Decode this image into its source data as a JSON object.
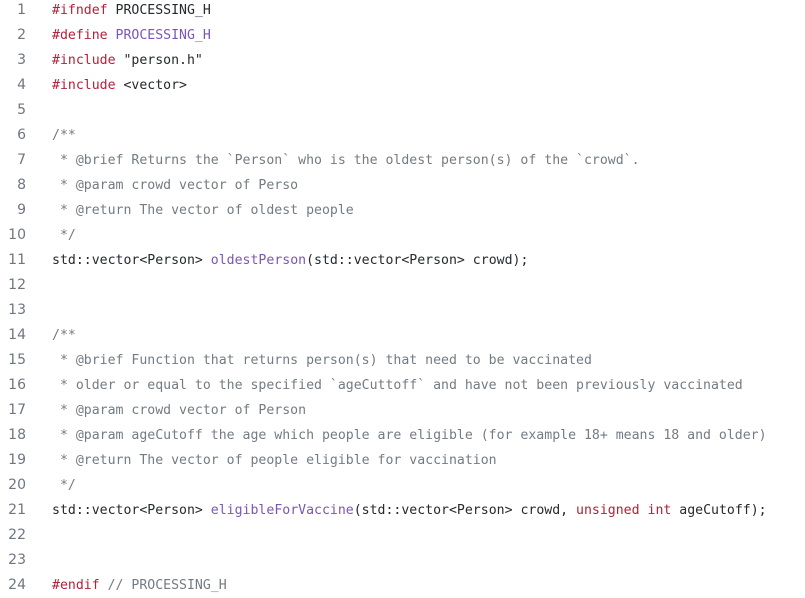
{
  "file": {
    "lines": [
      {
        "number": "1",
        "tokens": [
          {
            "t": "#ifndef",
            "k": "preproc"
          },
          {
            "t": " PROCESSING_H",
            "k": "plain"
          }
        ]
      },
      {
        "number": "2",
        "tokens": [
          {
            "t": "#define",
            "k": "preproc"
          },
          {
            "t": " ",
            "k": "plain"
          },
          {
            "t": "PROCESSING_H",
            "k": "entity"
          }
        ]
      },
      {
        "number": "3",
        "tokens": [
          {
            "t": "#include",
            "k": "preproc"
          },
          {
            "t": " \"person.h\"",
            "k": "string"
          }
        ]
      },
      {
        "number": "4",
        "tokens": [
          {
            "t": "#include",
            "k": "preproc"
          },
          {
            "t": " <vector>",
            "k": "string"
          }
        ]
      },
      {
        "number": "5",
        "tokens": []
      },
      {
        "number": "6",
        "tokens": [
          {
            "t": "/**",
            "k": "comment"
          }
        ]
      },
      {
        "number": "7",
        "tokens": [
          {
            "t": " * @brief Returns the `Person` who is the oldest person(s) of the `crowd`.",
            "k": "comment"
          }
        ]
      },
      {
        "number": "8",
        "tokens": [
          {
            "t": " * @param crowd vector of Perso",
            "k": "comment"
          }
        ]
      },
      {
        "number": "9",
        "tokens": [
          {
            "t": " * @return The vector of oldest people",
            "k": "comment"
          }
        ]
      },
      {
        "number": "10",
        "tokens": [
          {
            "t": " */",
            "k": "comment"
          }
        ]
      },
      {
        "number": "11",
        "tokens": [
          {
            "t": "std::vector<Person> ",
            "k": "plain"
          },
          {
            "t": "oldestPerson",
            "k": "entity"
          },
          {
            "t": "(std::vector<Person> crowd);",
            "k": "plain"
          }
        ]
      },
      {
        "number": "12",
        "tokens": []
      },
      {
        "number": "13",
        "tokens": []
      },
      {
        "number": "14",
        "tokens": [
          {
            "t": "/**",
            "k": "comment"
          }
        ]
      },
      {
        "number": "15",
        "tokens": [
          {
            "t": " * @brief Function that returns person(s) that need to be vaccinated",
            "k": "comment"
          }
        ]
      },
      {
        "number": "16",
        "tokens": [
          {
            "t": " * older or equal to the specified `ageCuttoff` and have not been previously vaccinated",
            "k": "comment"
          }
        ]
      },
      {
        "number": "17",
        "tokens": [
          {
            "t": " * @param crowd vector of Person",
            "k": "comment"
          }
        ]
      },
      {
        "number": "18",
        "tokens": [
          {
            "t": " * @param ageCutoff the age which people are eligible (for example 18+ means 18 and older)",
            "k": "comment"
          }
        ]
      },
      {
        "number": "19",
        "tokens": [
          {
            "t": " * @return The vector of people eligible for vaccination",
            "k": "comment"
          }
        ]
      },
      {
        "number": "20",
        "tokens": [
          {
            "t": " */",
            "k": "comment"
          }
        ]
      },
      {
        "number": "21",
        "tokens": [
          {
            "t": "std::vector<Person> ",
            "k": "plain"
          },
          {
            "t": "eligibleForVaccine",
            "k": "entity"
          },
          {
            "t": "(std::vector<Person> crowd, ",
            "k": "plain"
          },
          {
            "t": "unsigned",
            "k": "keyword"
          },
          {
            "t": " ",
            "k": "plain"
          },
          {
            "t": "int",
            "k": "keyword"
          },
          {
            "t": " ageCutoff);",
            "k": "plain"
          }
        ]
      },
      {
        "number": "22",
        "tokens": []
      },
      {
        "number": "23",
        "tokens": []
      },
      {
        "number": "24",
        "tokens": [
          {
            "t": "#endif",
            "k": "preproc"
          },
          {
            "t": " // PROCESSING_H",
            "k": "comment"
          }
        ]
      }
    ]
  },
  "colors": {
    "keyword": "#b3213a",
    "entity": "#7b56b3",
    "comment": "#737b83",
    "plain": "#24292e",
    "line_number": "#6e7681"
  }
}
